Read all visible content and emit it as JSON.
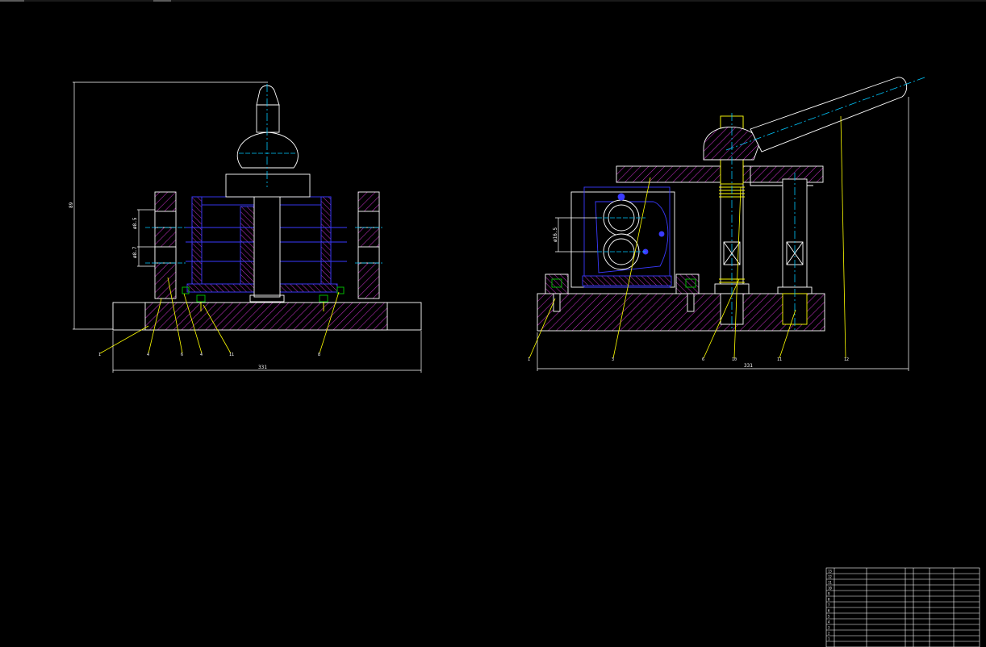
{
  "drawing": {
    "background": "#000000",
    "colors": {
      "outline": "#ffffff",
      "hatch": "#c030c0",
      "hidden": "#3a3aff",
      "center": "#00c8ff",
      "leader": "#ffff00",
      "fastener": "#00c800",
      "dimension": "#ffffff"
    }
  },
  "front_view": {
    "dim_overall_width": "331",
    "dim_height": "89",
    "dim_upper_bore": "ø8.5",
    "dim_lower_bore": "ø8.7",
    "balloons": [
      "1",
      "4",
      "6",
      "4",
      "11",
      "8"
    ]
  },
  "side_view": {
    "dim_overall_width": "331",
    "dim_gear_box": "ø16.5",
    "balloons": [
      "1",
      "3",
      "6",
      "10",
      "11",
      "12"
    ]
  },
  "bom": {
    "rows": [
      {
        "no": "13",
        "c1": "",
        "c2": "",
        "c3": "",
        "c4": ""
      },
      {
        "no": "12",
        "c1": "",
        "c2": "",
        "c3": "",
        "c4": ""
      },
      {
        "no": "11",
        "c1": "",
        "c2": "",
        "c3": "",
        "c4": ""
      },
      {
        "no": "10",
        "c1": "",
        "c2": "",
        "c3": "",
        "c4": ""
      },
      {
        "no": "9",
        "c1": "",
        "c2": "",
        "c3": "",
        "c4": ""
      },
      {
        "no": "8",
        "c1": "",
        "c2": "",
        "c3": "",
        "c4": ""
      },
      {
        "no": "7",
        "c1": "",
        "c2": "",
        "c3": "",
        "c4": ""
      },
      {
        "no": "6",
        "c1": "",
        "c2": "",
        "c3": "",
        "c4": ""
      },
      {
        "no": "5",
        "c1": "",
        "c2": "",
        "c3": "",
        "c4": ""
      },
      {
        "no": "4",
        "c1": "",
        "c2": "",
        "c3": "",
        "c4": ""
      },
      {
        "no": "3",
        "c1": "",
        "c2": "",
        "c3": "",
        "c4": ""
      },
      {
        "no": "2",
        "c1": "",
        "c2": "",
        "c3": "",
        "c4": ""
      },
      {
        "no": "1",
        "c1": "",
        "c2": "",
        "c3": "",
        "c4": ""
      }
    ]
  }
}
